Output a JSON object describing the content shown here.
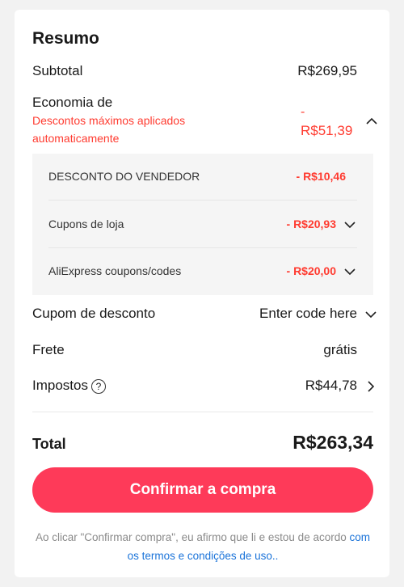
{
  "summary": {
    "title": "Resumo",
    "subtotal_label": "Subtotal",
    "subtotal_value": "R$269,95",
    "savings_label": "Economia de",
    "savings_note": "Descontos máximos aplicados automaticamente",
    "savings_sign": "-",
    "savings_value": "R$51,39",
    "discounts": [
      {
        "label": "DESCONTO DO VENDEDOR",
        "value": "- R$10,46"
      },
      {
        "label": "Cupons de loja",
        "value": "- R$20,93"
      },
      {
        "label": "AliExpress coupons/codes",
        "value": "- R$20,00"
      }
    ],
    "coupon_label": "Cupom de desconto",
    "coupon_placeholder": "Enter code here",
    "shipping_label": "Frete",
    "shipping_value": "grátis",
    "taxes_label": "Impostos",
    "taxes_help_icon": "?",
    "taxes_value": "R$44,78",
    "total_label": "Total",
    "total_value": "R$263,34",
    "confirm_label": "Confirmar a compra",
    "legal_prefix": "Ao clicar \"Confirmar compra\", eu afirmo que li e estou de acordo",
    "legal_link": "com os termos e condições de uso.."
  },
  "colors": {
    "accent": "#fe3a59",
    "discount_red": "#ff3b30",
    "link": "#1a73d9"
  }
}
